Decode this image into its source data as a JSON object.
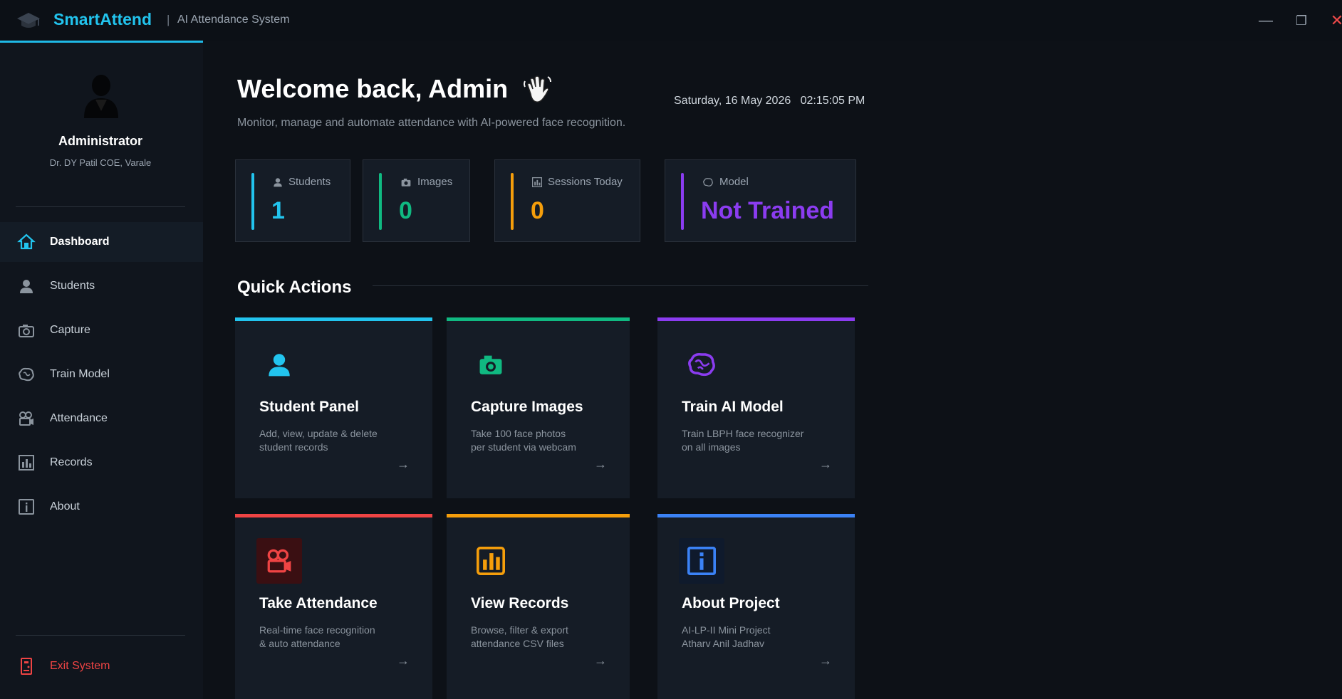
{
  "app": {
    "name": "SmartAttend",
    "separator": "|",
    "subtitle": "AI Attendance System",
    "window_controls": {
      "minimize": "—",
      "maximize": "❐",
      "close": "✕"
    }
  },
  "sidebar": {
    "profile": {
      "name": "Administrator",
      "college": "Dr. DY Patil COE, Varale"
    },
    "items": [
      {
        "label": "Dashboard",
        "icon": "home-icon",
        "active": true
      },
      {
        "label": "Students",
        "icon": "user-icon"
      },
      {
        "label": "Capture",
        "icon": "camera-icon"
      },
      {
        "label": "Train Model",
        "icon": "brain-icon"
      },
      {
        "label": "Attendance",
        "icon": "video-camera-icon"
      },
      {
        "label": "Records",
        "icon": "bar-chart-icon"
      },
      {
        "label": "About",
        "icon": "info-icon"
      }
    ],
    "exit": {
      "label": "Exit System",
      "icon": "exit-door-icon"
    }
  },
  "header": {
    "welcome": "Welcome back, Admin",
    "datetime": "Saturday, 16 May 2026   02:15:05 PM",
    "subtitle": "Monitor, manage and automate attendance with AI-powered face recognition."
  },
  "stats": [
    {
      "label": "Students",
      "value": "1",
      "color": "#22c4ee",
      "icon": "user-icon"
    },
    {
      "label": "Images",
      "value": "0",
      "color": "#10b981",
      "icon": "camera-icon"
    },
    {
      "label": "Sessions Today",
      "value": "0",
      "color": "#f59e0b",
      "icon": "bar-chart-icon"
    },
    {
      "label": "Model",
      "value": "Not Trained",
      "color": "#8b3cf0",
      "icon": "brain-icon"
    }
  ],
  "quick_actions": {
    "title": "Quick Actions",
    "cards": [
      {
        "title": "Student Panel",
        "desc1": "Add, view, update & delete",
        "desc2": "student records",
        "arrow": "→",
        "color": "#22c4ee",
        "icon": "user-icon"
      },
      {
        "title": "Capture Images",
        "desc1": "Take 100 face photos",
        "desc2": "per student via webcam",
        "arrow": "→",
        "color": "#10b981",
        "icon": "camera-icon"
      },
      {
        "title": "Train AI Model",
        "desc1": "Train LBPH face recognizer",
        "desc2": "on all images",
        "arrow": "→",
        "color": "#8b3cf0",
        "icon": "brain-icon"
      },
      {
        "title": "Take Attendance",
        "desc1": "Real-time face recognition",
        "desc2": "& auto attendance",
        "arrow": "→",
        "color": "#ef4444",
        "icon": "video-camera-icon"
      },
      {
        "title": "View Records",
        "desc1": "Browse, filter & export",
        "desc2": "attendance CSV files",
        "arrow": "→",
        "color": "#f59e0b",
        "icon": "bar-chart-icon"
      },
      {
        "title": "About Project",
        "desc1": "AI-LP-II Mini Project",
        "desc2": "Atharv Anil Jadhav",
        "arrow": "→",
        "color": "#3b82f6",
        "icon": "info-icon"
      }
    ]
  }
}
